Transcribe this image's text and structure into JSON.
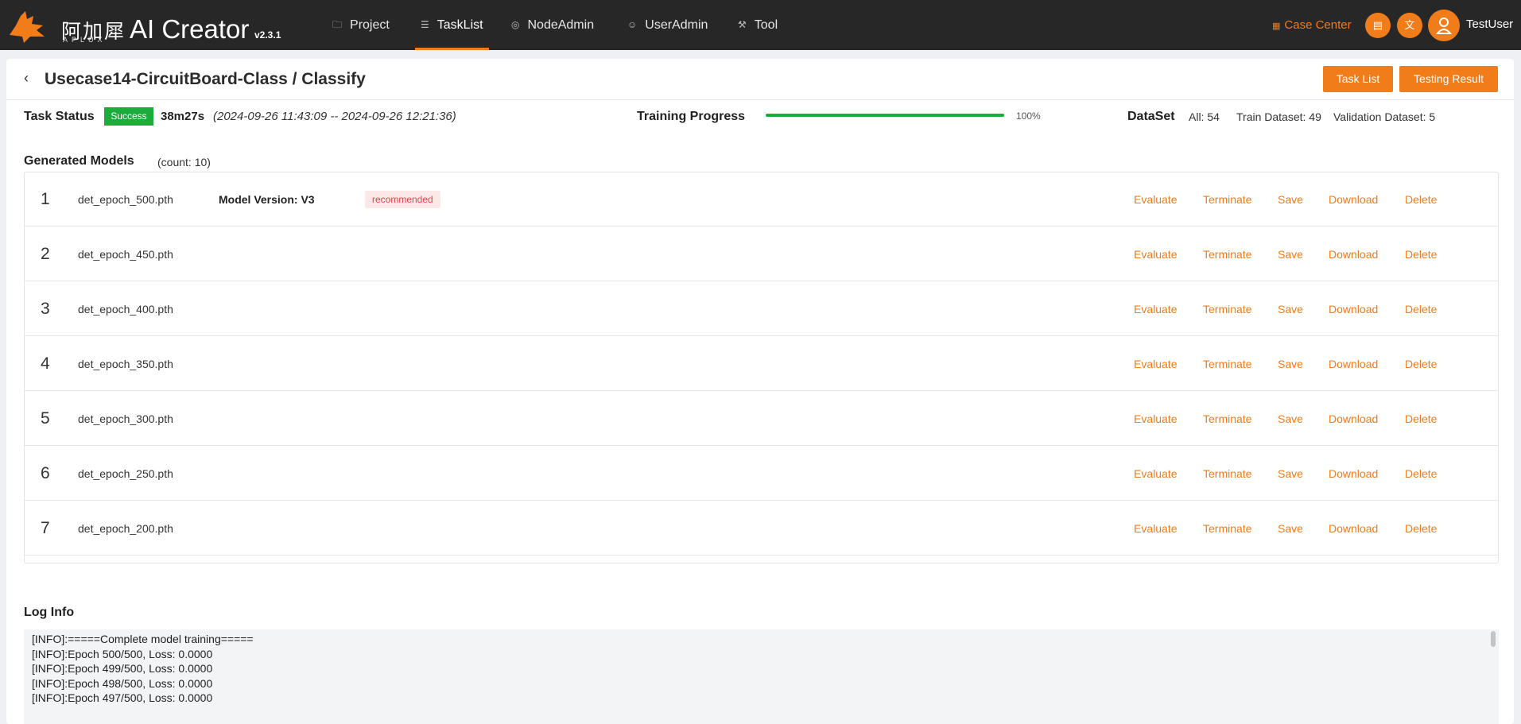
{
  "brand": {
    "cn": "阿加犀",
    "sub": "APLUX",
    "title": "AI Creator",
    "version": "v2.3.1"
  },
  "nav": {
    "items": [
      {
        "label": "Project",
        "icon": "folder-icon"
      },
      {
        "label": "TaskList",
        "icon": "list-icon"
      },
      {
        "label": "NodeAdmin",
        "icon": "node-icon"
      },
      {
        "label": "UserAdmin",
        "icon": "users-icon"
      },
      {
        "label": "Tool",
        "icon": "wrench-icon"
      }
    ],
    "active": "TaskList",
    "case_center": "Case Center",
    "username": "TestUser"
  },
  "page": {
    "title": "Usecase14-CircuitBoard-Class / Classify",
    "task_list_btn": "Task List",
    "testing_result_btn": "Testing Result"
  },
  "status": {
    "label": "Task Status",
    "badge": "Success",
    "duration": "38m27s",
    "range": "(2024-09-26 11:43:09 -- 2024-09-26 12:21:36)",
    "progress_label": "Training Progress",
    "progress_value": 100,
    "progress_text": "100%",
    "dataset_label": "DataSet",
    "all": "All: 54",
    "train": "Train Dataset: 49",
    "validation": "Validation Dataset: 5"
  },
  "models": {
    "title": "Generated Models",
    "count": "(count:  10)",
    "version_label": "Model Version:  V3",
    "recommended": "recommended",
    "actions": {
      "evaluate": "Evaluate",
      "terminate": "Terminate",
      "save": "Save",
      "download": "Download",
      "delete": "Delete"
    },
    "rows": [
      {
        "index": "1",
        "name": "det_epoch_500.pth"
      },
      {
        "index": "2",
        "name": "det_epoch_450.pth"
      },
      {
        "index": "3",
        "name": "det_epoch_400.pth"
      },
      {
        "index": "4",
        "name": "det_epoch_350.pth"
      },
      {
        "index": "5",
        "name": "det_epoch_300.pth"
      },
      {
        "index": "6",
        "name": "det_epoch_250.pth"
      },
      {
        "index": "7",
        "name": "det_epoch_200.pth"
      }
    ]
  },
  "log": {
    "title": "Log Info",
    "lines": [
      "[INFO]:=====Complete model training=====",
      "[INFO]:Epoch 500/500, Loss: 0.0000",
      "[INFO]:Epoch 499/500, Loss: 0.0000",
      "[INFO]:Epoch 498/500, Loss: 0.0000",
      "[INFO]:Epoch 497/500, Loss: 0.0000"
    ]
  },
  "colors": {
    "accent": "#f07c1a",
    "success": "#1aad3b",
    "topbar": "#272727"
  }
}
